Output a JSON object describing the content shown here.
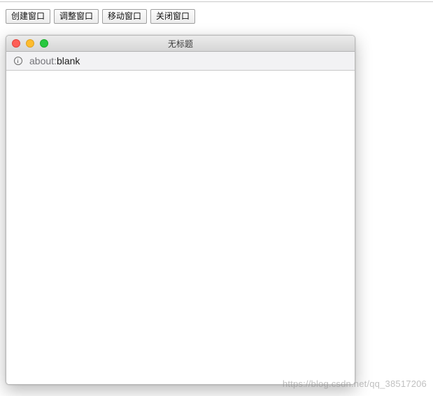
{
  "toolbar": {
    "buttons": [
      {
        "label": "创建窗口"
      },
      {
        "label": "调整窗口"
      },
      {
        "label": "移动窗口"
      },
      {
        "label": "关闭窗口"
      }
    ]
  },
  "popup": {
    "title": "无标题",
    "address": {
      "scheme": "about:",
      "path": "blank"
    }
  },
  "watermark": "https://blog.csdn.net/qq_38517206",
  "colors": {
    "close_light": "#fe5f57",
    "minimize_light": "#febc2e",
    "zoom_light": "#28c840"
  },
  "icons": [
    "info-icon"
  ]
}
